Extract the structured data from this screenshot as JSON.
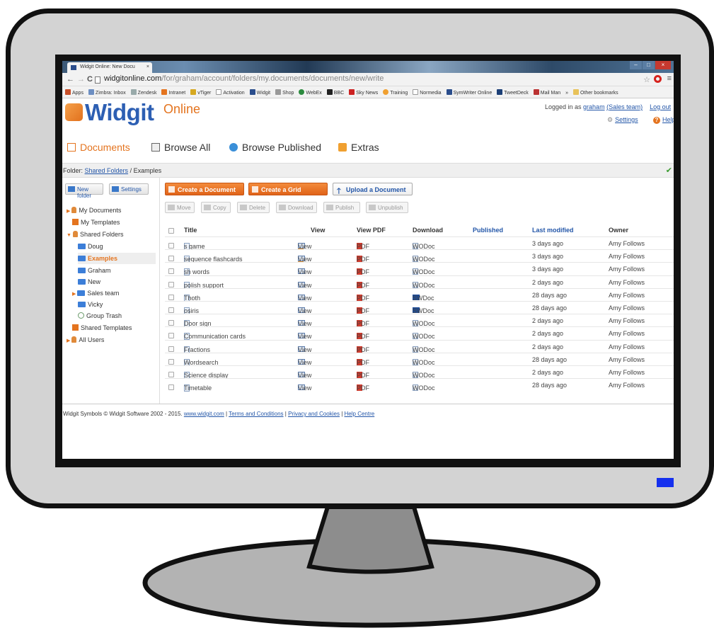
{
  "browser": {
    "tab_title": "Widgit Online: New Docu",
    "url_domain": "widgitonline.com",
    "url_path": "/for/graham/account/folders/my.documents/documents/new/write",
    "bookmarks": [
      "Apps",
      "Zimbra: Inbox",
      "Zendesk",
      "Intranet",
      "vTiger",
      "Activation",
      "Widgit",
      "Shop",
      "WebEx",
      "BBC",
      "Sky News",
      "Training",
      "Normedia",
      "SymWriter Online",
      "TweetDeck",
      "Mail Man",
      "»",
      "Other bookmarks"
    ]
  },
  "header": {
    "logo_word": "Widgit",
    "logo_online": "Online",
    "logged_in_prefix": "Logged in as ",
    "user": "graham",
    "team": "(Sales team)",
    "logout": "Log out",
    "settings": "Settings",
    "help": "Help"
  },
  "nav": {
    "documents": "Documents",
    "browse_all": "Browse All",
    "browse_published": "Browse Published",
    "extras": "Extras"
  },
  "folderbar": {
    "label": "Folder: ",
    "shared": "Shared Folders",
    "rest": " / Examples"
  },
  "sidebar": {
    "new_folder": "New folder",
    "settings": "Settings",
    "items": [
      "My Documents",
      "My Templates",
      "Shared Folders",
      "Doug",
      "Examples",
      "Graham",
      "New",
      "Sales team",
      "Vicky",
      "Group Trash",
      "Shared Templates",
      "All Users"
    ]
  },
  "toolbar": {
    "create_document": "Create a Document",
    "create_grid": "Create a Grid",
    "upload": "Upload a Document",
    "move": "Move",
    "copy": "Copy",
    "delete": "Delete",
    "download": "Download",
    "publish": "Publish",
    "unpublish": "Unpublish"
  },
  "table": {
    "headers": [
      "Title",
      "View",
      "View PDF",
      "Download",
      "Published",
      "Last modified",
      "Owner"
    ],
    "view_label": "View",
    "pdf_label": "PDF",
    "rows": [
      {
        "title": "s game",
        "download": "WODoc",
        "modified": "3 days ago",
        "owner": "Amy Follows"
      },
      {
        "title": "sequence flashcards",
        "download": "WODoc",
        "modified": "3 days ago",
        "owner": "Amy Follows"
      },
      {
        "title": "sh words",
        "download": "WODoc",
        "modified": "3 days ago",
        "owner": "Amy Follows"
      },
      {
        "title": "polish support",
        "download": "WODoc",
        "modified": "2 days ago",
        "owner": "Amy Follows"
      },
      {
        "title": "Thoth",
        "download": "SWDoc",
        "modified": "28 days ago",
        "owner": "Amy Follows"
      },
      {
        "title": "osiris",
        "download": "SWDoc",
        "modified": "28 days ago",
        "owner": "Amy Follows"
      },
      {
        "title": "Door sign",
        "download": "WODoc",
        "modified": "2 days ago",
        "owner": "Amy Follows"
      },
      {
        "title": "Communication cards",
        "download": "WODoc",
        "modified": "2 days ago",
        "owner": "Amy Follows"
      },
      {
        "title": "Fractions",
        "download": "WODoc",
        "modified": "2 days ago",
        "owner": "Amy Follows"
      },
      {
        "title": "Wordsearch",
        "download": "WODoc",
        "modified": "28 days ago",
        "owner": "Amy Follows"
      },
      {
        "title": "Science display",
        "download": "WODoc",
        "modified": "2 days ago",
        "owner": "Amy Follows"
      },
      {
        "title": "Timetable",
        "download": "WODoc",
        "modified": "28 days ago",
        "owner": "Amy Follows"
      }
    ]
  },
  "footer": {
    "copyright": "Widgit Symbols © Widgit Software 2002 - 2015. ",
    "site": "www.widgit.com",
    "sep": " | ",
    "terms": "Terms and Conditions",
    "privacy": "Privacy and Cookies",
    "help": "Help Centre"
  },
  "colors": {
    "accent": "#e4741f",
    "brand_blue": "#2d5fb3",
    "link": "#2356a8",
    "led": "#1530ee"
  }
}
